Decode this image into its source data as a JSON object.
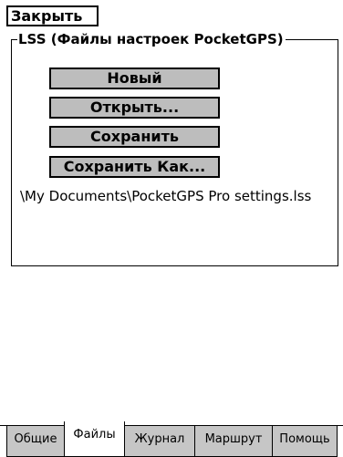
{
  "header": {
    "close_label": "Закрыть"
  },
  "group": {
    "title": "LSS (Файлы настроек PocketGPS)",
    "buttons": [
      {
        "label": "Новый"
      },
      {
        "label": "Открыть..."
      },
      {
        "label": "Сохранить"
      },
      {
        "label": "Сохранить Как..."
      }
    ],
    "current_file": "\\My Documents\\PocketGPS Pro settings.lss"
  },
  "tabs": [
    {
      "label": "Общие"
    },
    {
      "label": "Файлы",
      "active": true
    },
    {
      "label": "Журнал"
    },
    {
      "label": "Маршрут"
    },
    {
      "label": "Помощь"
    }
  ]
}
